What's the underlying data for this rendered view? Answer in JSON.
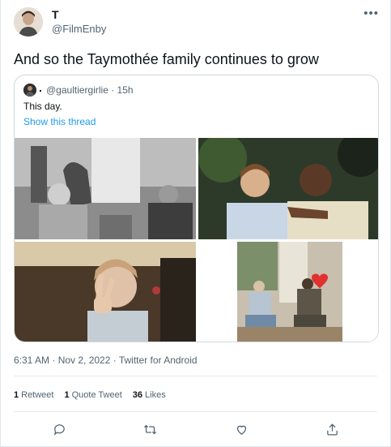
{
  "tweet": {
    "author_name": "T",
    "author_handle": "@FilmEnby",
    "more_label": "•••",
    "text": "And so the Taymothée family continues to grow",
    "timestamp": "6:31 AM · Nov 2, 2022 · Twitter for Android"
  },
  "quote": {
    "display_name": ".",
    "handle_time": "@gaultiergirlie · 15h",
    "text": "This day.",
    "thread_link": "Show this thread"
  },
  "photos": [
    {
      "icon": "photo-icon"
    },
    {
      "icon": "photo-icon"
    },
    {
      "icon": "photo-icon"
    },
    {
      "icon": "photo-icon",
      "emoji": "❤️"
    }
  ],
  "stats": {
    "retweets_count": "1",
    "retweets_label": "Retweet",
    "quotes_count": "1",
    "quotes_label": "Quote Tweet",
    "likes_count": "36",
    "likes_label": "Likes"
  },
  "actions": [
    "reply-icon",
    "retweet-icon",
    "like-icon",
    "share-icon"
  ],
  "colors": {
    "link": "#1d9bf0",
    "secondary_text": "#536471",
    "border": "#cfd9de"
  }
}
